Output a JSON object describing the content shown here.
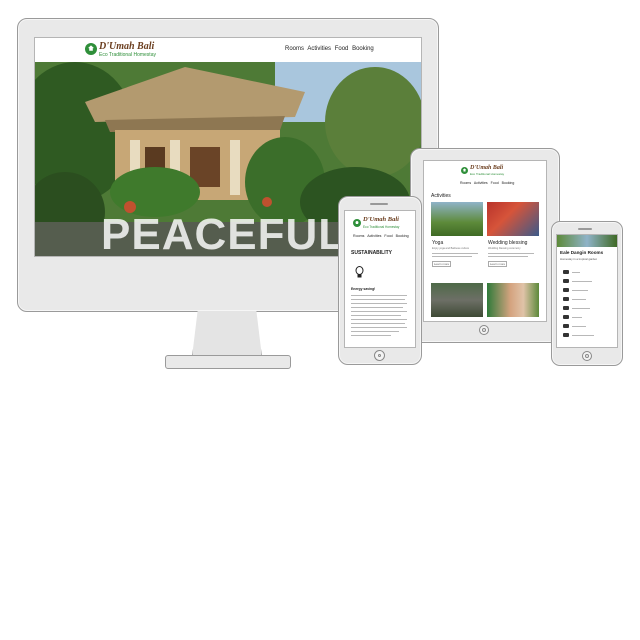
{
  "brand": {
    "name": "D'Umah Bali",
    "tagline": "Eco Traditional Homestay",
    "accent": "#2f8f3a",
    "title_color": "#6b3e1f"
  },
  "nav": {
    "items": [
      "Rooms",
      "Activities",
      "Food",
      "Booking"
    ]
  },
  "desktop": {
    "hero_word": "PEACEFUL"
  },
  "tablet": {
    "section_title": "Activities",
    "cards": [
      {
        "title": "Yoga",
        "subtitle": "Enjoy yoga and Balinese culture",
        "button": "Learn more"
      },
      {
        "title": "Wedding blessing",
        "subtitle": "Wedding blessing ceremony",
        "button": "Learn more"
      }
    ]
  },
  "phone": {
    "section_title": "SUSTAINABILITY",
    "item_title": "Energy saving!"
  },
  "small_phone": {
    "title": "Eale Dangin Rooms",
    "subtitle": "Homestay in a tropical garden"
  }
}
